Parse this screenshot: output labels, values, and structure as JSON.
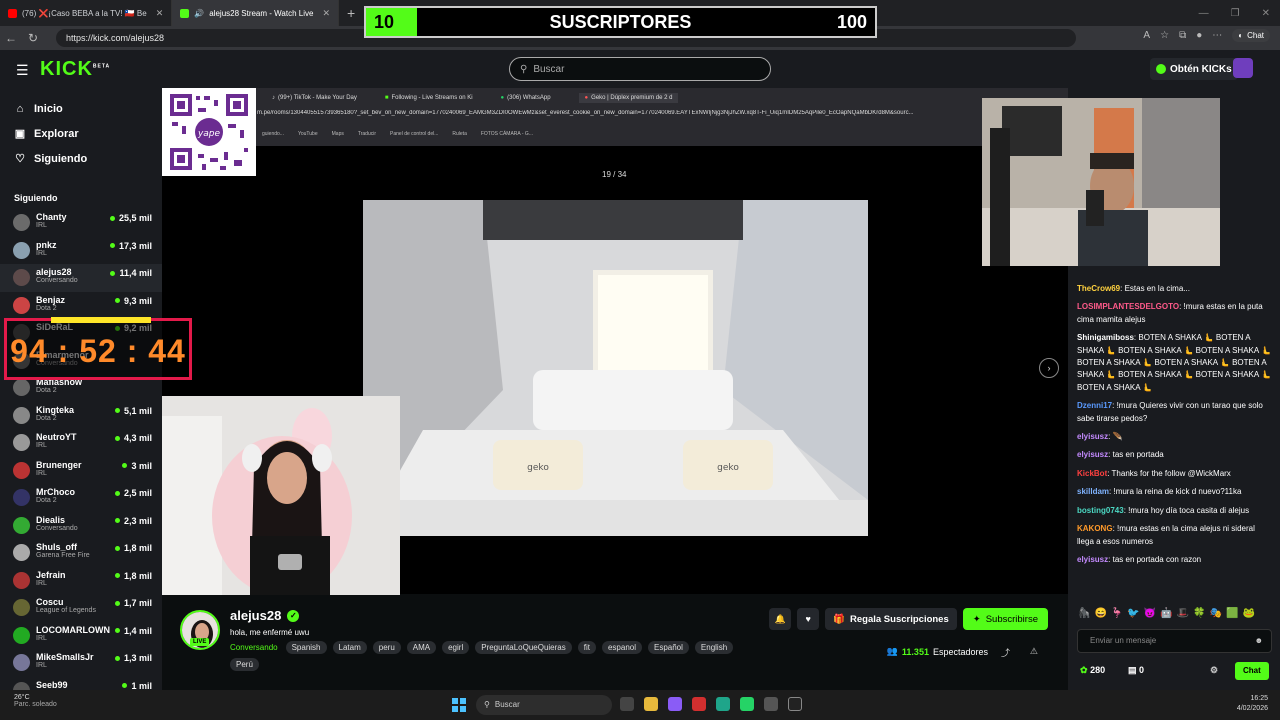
{
  "browser": {
    "tabs": [
      {
        "label": "(76) ❌¡Caso BEBA a la TV! 🇨🇱 Be",
        "active": false
      },
      {
        "label": "alejus28 Stream - Watch Live",
        "active": true
      }
    ],
    "url": "https://kick.com/alejus28",
    "chat_button": "Chat"
  },
  "sub_goal": {
    "current": "10",
    "title": "SUSCRIPTORES",
    "goal": "100",
    "progress_fraction": 0.1
  },
  "header": {
    "logo": "KICK",
    "logo_sup": "BETA",
    "search_placeholder": "Buscar",
    "obtain_kicks": "Obtén KICKs"
  },
  "sidebar": {
    "nav": [
      {
        "label": "Inicio",
        "icon": "home-icon"
      },
      {
        "label": "Explorar",
        "icon": "compass-icon"
      },
      {
        "label": "Siguiendo",
        "icon": "heart-icon"
      }
    ],
    "section_title": "Siguiendo",
    "following": [
      {
        "name": "Chanty",
        "category": "IRL",
        "viewers": "25,5 mil",
        "color": "#6b6b6b"
      },
      {
        "name": "pnkz",
        "category": "IRL",
        "viewers": "17,3 mil",
        "color": "#8aa0b0"
      },
      {
        "name": "alejus28",
        "category": "Conversando",
        "viewers": "11,4 mil",
        "color": "#5d4a4a"
      },
      {
        "name": "Benjaz",
        "category": "Dota 2",
        "viewers": "9,3 mil",
        "color": "#c44"
      },
      {
        "name": "SiDeRaL",
        "category": "",
        "viewers": "9,2 mil",
        "color": "#555"
      },
      {
        "name": "Elmarmenor",
        "category": "Conversando",
        "viewers": "",
        "color": "#777"
      },
      {
        "name": "Mafiasnow",
        "category": "Dota 2",
        "viewers": "",
        "color": "#666"
      },
      {
        "name": "Kingteka",
        "category": "Dota 2",
        "viewers": "5,1 mil",
        "color": "#888"
      },
      {
        "name": "NeutroYT",
        "category": "IRL",
        "viewers": "4,3 mil",
        "color": "#999"
      },
      {
        "name": "Brunenger",
        "category": "IRL",
        "viewers": "3 mil",
        "color": "#b33"
      },
      {
        "name": "MrChoco",
        "category": "Dota 2",
        "viewers": "2,5 mil",
        "color": "#336"
      },
      {
        "name": "Diealis",
        "category": "Conversando",
        "viewers": "2,3 mil",
        "color": "#3a3"
      },
      {
        "name": "Shuls_off",
        "category": "Garena Free Fire",
        "viewers": "1,8 mil",
        "color": "#aaa"
      },
      {
        "name": "Jefrain",
        "category": "IRL",
        "viewers": "1,8 mil",
        "color": "#a33"
      },
      {
        "name": "Coscu",
        "category": "League of Legends",
        "viewers": "1,7 mil",
        "color": "#663"
      },
      {
        "name": "LOCOMARLOWN",
        "category": "IRL",
        "viewers": "1,4 mil",
        "color": "#2a2"
      },
      {
        "name": "MikeSmallsJr",
        "category": "IRL",
        "viewers": "1,3 mil",
        "color": "#779"
      },
      {
        "name": "Seeb99",
        "category": "",
        "viewers": "1 mil",
        "color": "#555"
      }
    ]
  },
  "timer": {
    "value": "94 : 52 : 44"
  },
  "video": {
    "inner_tabs": [
      "(99+) TikTok - Make Your Day",
      "Following - Live Streams on Ki",
      "(306) WhatsApp",
      "Geko | Dúplex premium de 2 d"
    ],
    "inner_url": "m.pe/rooms/1304405515739365180?_set_bev_on_new_domain=1770240069_EAMGM3ZDI0OWEwMz&set_everest_cookie_on_new_domain=1770240069.EAYTExNWIjNjg3NjJhZW.xq8T-Fi_Uiq1mIDM25AqPile0_EcOapNQaMbDKrd8M&sourc...",
    "bookmarks": [
      "guiendo...",
      "YouTube",
      "Maps",
      "Traducir",
      "Panel de control del...",
      "Ruleta",
      "FOTOS CÁMARA - G..."
    ],
    "page_counter": "19 / 34",
    "pillow_brand": "geko"
  },
  "stream": {
    "streamer": "alejus28",
    "title": "hola, me enfermé uwu",
    "live_label": "LIVE",
    "category": "Conversando",
    "tags": [
      "Spanish",
      "Latam",
      "peru",
      "AMA",
      "egirl",
      "PreguntaLoQueQuieras",
      "fit",
      "espanol",
      "Español",
      "English",
      "Perú"
    ],
    "gift_label": "Regala Suscripciones",
    "subscribe_label": "Subscribirse",
    "viewers": "11.351",
    "viewers_label": "Espectadores"
  },
  "chat": {
    "messages": [
      {
        "user": "TheCrow69",
        "color": "#ffd23f",
        "text": "Estas en la cima..."
      },
      {
        "user": "LOSIMPLANTESDELGOTO",
        "color": "#ff5a8a",
        "text": "!mura estas en la puta cima mamita alejus"
      },
      {
        "user": "Shinigamiboss",
        "color": "#ffffff",
        "text": "BOTEN A SHAKA 🫷 BOTEN A SHAKA 🫷 BOTEN A SHAKA 🫷 BOTEN A SHAKA 🫷 BOTEN A SHAKA 🫷 BOTEN A SHAKA 🫷 BOTEN A SHAKA 🫷 BOTEN A SHAKA 🫷 BOTEN A SHAKA 🫷 BOTEN A SHAKA 🫷"
      },
      {
        "user": "Dzenni17",
        "color": "#5a9aff",
        "text": "!mura Quieres vivir con un tarao que solo sabe tirarse pedos?"
      },
      {
        "user": "elyisusz",
        "color": "#c48bff",
        "text": "🪶"
      },
      {
        "user": "elyisusz",
        "color": "#c48bff",
        "text": "tas en portada"
      },
      {
        "user": "KickBot",
        "color": "#ff4040",
        "text": "Thanks for the follow @WickMarx"
      },
      {
        "user": "skilldam",
        "color": "#7fb3ff",
        "text": "!mura la reina de kick d nuevo?11ka"
      },
      {
        "user": "bosting0743",
        "color": "#4cd9c4",
        "text": "!mura hoy día toca casita di alejus"
      },
      {
        "user": "KAKONG",
        "color": "#ff9a2a",
        "text": "!mura estas en la cima alejus ni sideral llega a esos numeros"
      },
      {
        "user": "elyisusz",
        "color": "#c48bff",
        "text": "tas en portada con razon"
      }
    ],
    "input_placeholder": "Enviar un mensaje",
    "points": "280",
    "drops": "0",
    "chat_button": "Chat"
  },
  "taskbar": {
    "temperature": "26°C",
    "weather": "Parc. soleado",
    "search": "Buscar",
    "time": "16:25",
    "date": "4/02/2026"
  },
  "colors": {
    "kick_green": "#53fc18",
    "bg": "#0b0e0f",
    "panel": "#191b1f",
    "timer_border": "#e31a4a",
    "timer_text": "#ff8a2a"
  }
}
